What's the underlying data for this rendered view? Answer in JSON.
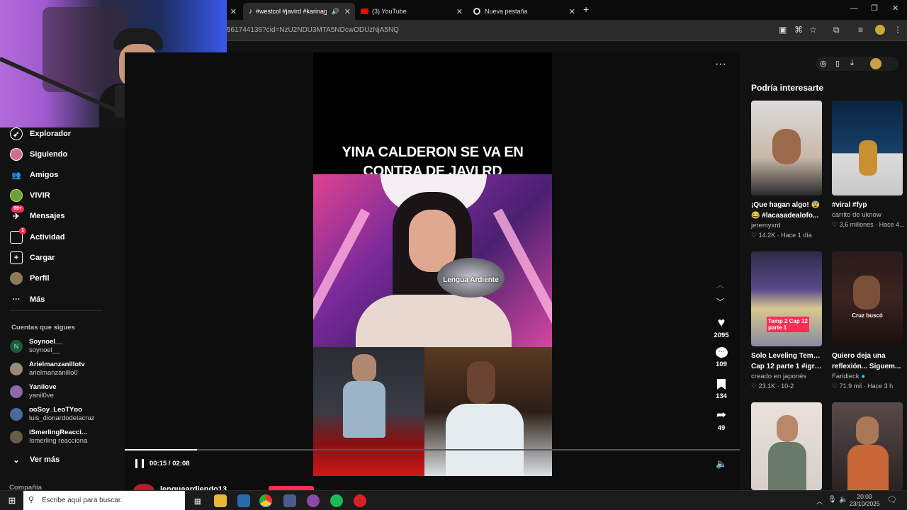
{
  "browser": {
    "tabs": [
      {
        "label": "#westcol #javird #karinaga",
        "active": true
      },
      {
        "label": "(3) YouTube",
        "active": false
      },
      {
        "label": "Nueva pestaña",
        "active": false
      }
    ],
    "new_tab": "+",
    "url": "561744136?cid=NzU2NDU3MTA5NDcwODUzNjA5NQ"
  },
  "leftnav": {
    "items": [
      {
        "label": "Explorador",
        "icon": "compass-icon"
      },
      {
        "label": "Siguiendo",
        "icon": "following-avatar-icon"
      },
      {
        "label": "Amigos",
        "icon": "friends-icon"
      },
      {
        "label": "VIVIR",
        "icon": "live-icon"
      },
      {
        "label": "Mensajes",
        "icon": "messages-icon",
        "badge": "99+"
      },
      {
        "label": "Actividad",
        "icon": "activity-icon",
        "badge": "1"
      },
      {
        "label": "Cargar",
        "icon": "upload-icon"
      },
      {
        "label": "Perfil",
        "icon": "profile-icon"
      },
      {
        "label": "Más",
        "icon": "more-icon"
      }
    ],
    "following_header": "Cuentas que sigues",
    "accounts": [
      {
        "name": "Soynoel__",
        "handle": "soynoel__",
        "initial": "N"
      },
      {
        "name": "Arielmanzanillotv",
        "handle": "arielmanzanillo0",
        "initial": ""
      },
      {
        "name": "Yanilove",
        "handle": "yanil0ve",
        "initial": ""
      },
      {
        "name": "ɒoSoy_LeoTYɒo",
        "handle": "luis_dionardodelacruz",
        "initial": ""
      },
      {
        "name": "iSmerlingReacci...",
        "handle": "Ismerling reacciona",
        "initial": ""
      }
    ],
    "see_more": "Ver más",
    "company": "Compañía"
  },
  "video": {
    "title": "YINA CALDERON SE VA EN CONTRA DE JAVI RD",
    "watermark": "Lengua Ardiente",
    "time": "00:15 / 02:08",
    "progress": 0.117,
    "author": "lenguaardiendo13",
    "likes": "2095",
    "comments": "109",
    "saves": "134",
    "shares": "49"
  },
  "recommended": {
    "header": "Podría interesarte",
    "cards": [
      {
        "title": "¡Que hagan algo! 😨",
        "title2": "😂 #lacasadealofo...",
        "user": "jeremyxrd",
        "likes": "14.2K",
        "time": "Hace 1 día",
        "thumb_text": ""
      },
      {
        "title": "#viral #fyp",
        "title2": "",
        "user": "carrito de uknow",
        "likes": "3,6 millones",
        "time": "Hace 4...",
        "thumb_text": ""
      },
      {
        "title": "Solo Leveling Temp 2",
        "title2": "Cap 12 parte 1 #igri...",
        "user": "creado en japonés",
        "likes": "23.1K",
        "time": "10-2",
        "thumb_text": "Temp 2 Cap 12 parte 1"
      },
      {
        "title": "Quiero deja una",
        "title2": "reflexión... Síguem...",
        "user": "Faridieck",
        "likes": "71.9 mil",
        "time": "Hace 3 h",
        "thumb_text": "Cruz buscó"
      },
      {
        "title": "",
        "title2": "",
        "user": "",
        "likes": "",
        "time": "",
        "thumb_text": ""
      },
      {
        "title": "",
        "title2": "",
        "user": "",
        "likes": "",
        "time": "",
        "thumb_text": ""
      }
    ]
  },
  "taskbar": {
    "search_placeholder": "Escribe aquí para buscar.",
    "time": "20:00",
    "date": "23/10/2025"
  },
  "colors": {
    "accent": "#fe2c55",
    "background": "#121212"
  }
}
